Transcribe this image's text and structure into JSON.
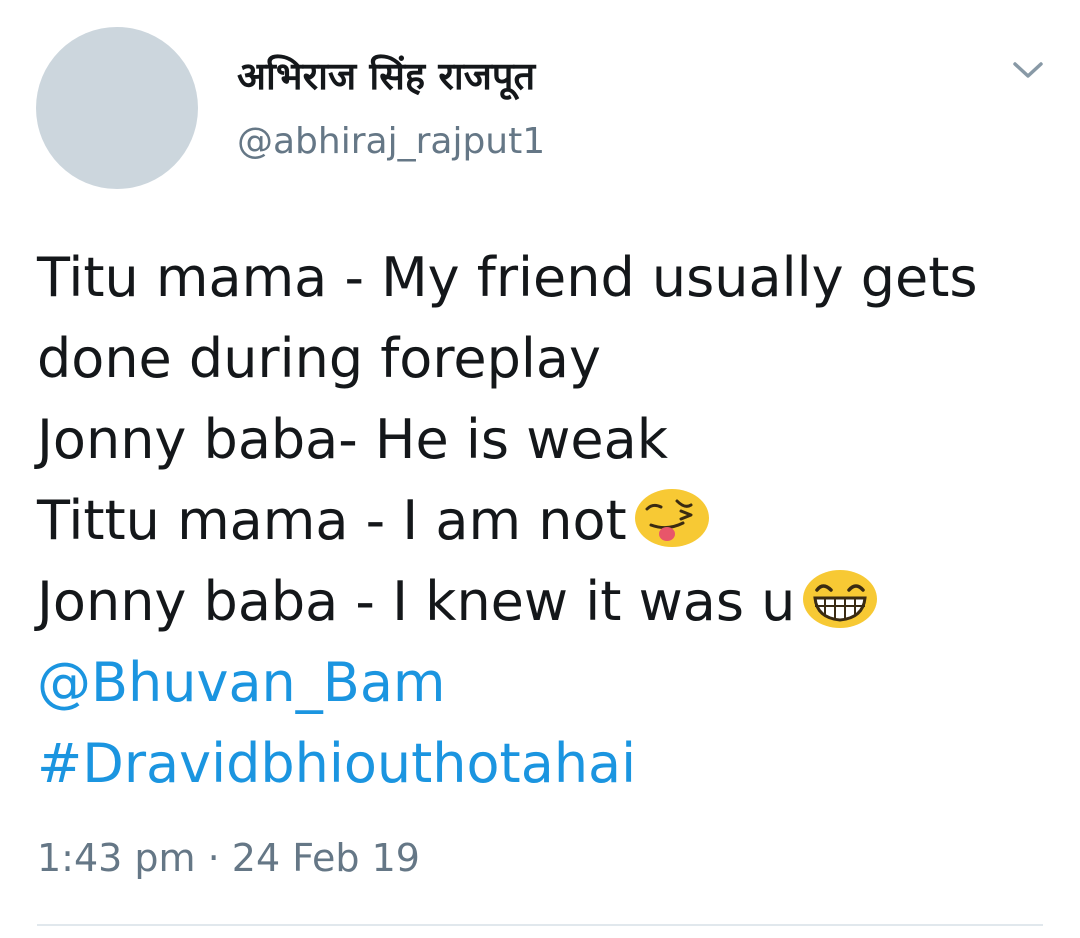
{
  "author": {
    "display_name": "अभिराज सिंह राजपूत",
    "handle": "@abhiraj_rajput1",
    "avatar_color": "#ccd6dd"
  },
  "menu": {
    "icon": "chevron-down-icon"
  },
  "tweet": {
    "line1": "Titu mama - My friend usually gets",
    "line2": "done during foreplay",
    "line3": "Jonny baba- He is weak",
    "line4": "Tittu mama - I am not",
    "line4_emoji": "winking-face-with-tongue-emoji",
    "line5": "Jonny baba - I knew it was u",
    "line5_emoji": "grinning-face-emoji",
    "mention": "@Bhuvan_Bam",
    "hashtag": "#Dravidbhiouthotahai"
  },
  "timestamp": "1:43 pm · 24 Feb 19",
  "colors": {
    "text": "#14171a",
    "secondary": "#657786",
    "link": "#1b95e0",
    "divider": "#e1e8ed",
    "emoji_yellow": "#f7c934"
  }
}
